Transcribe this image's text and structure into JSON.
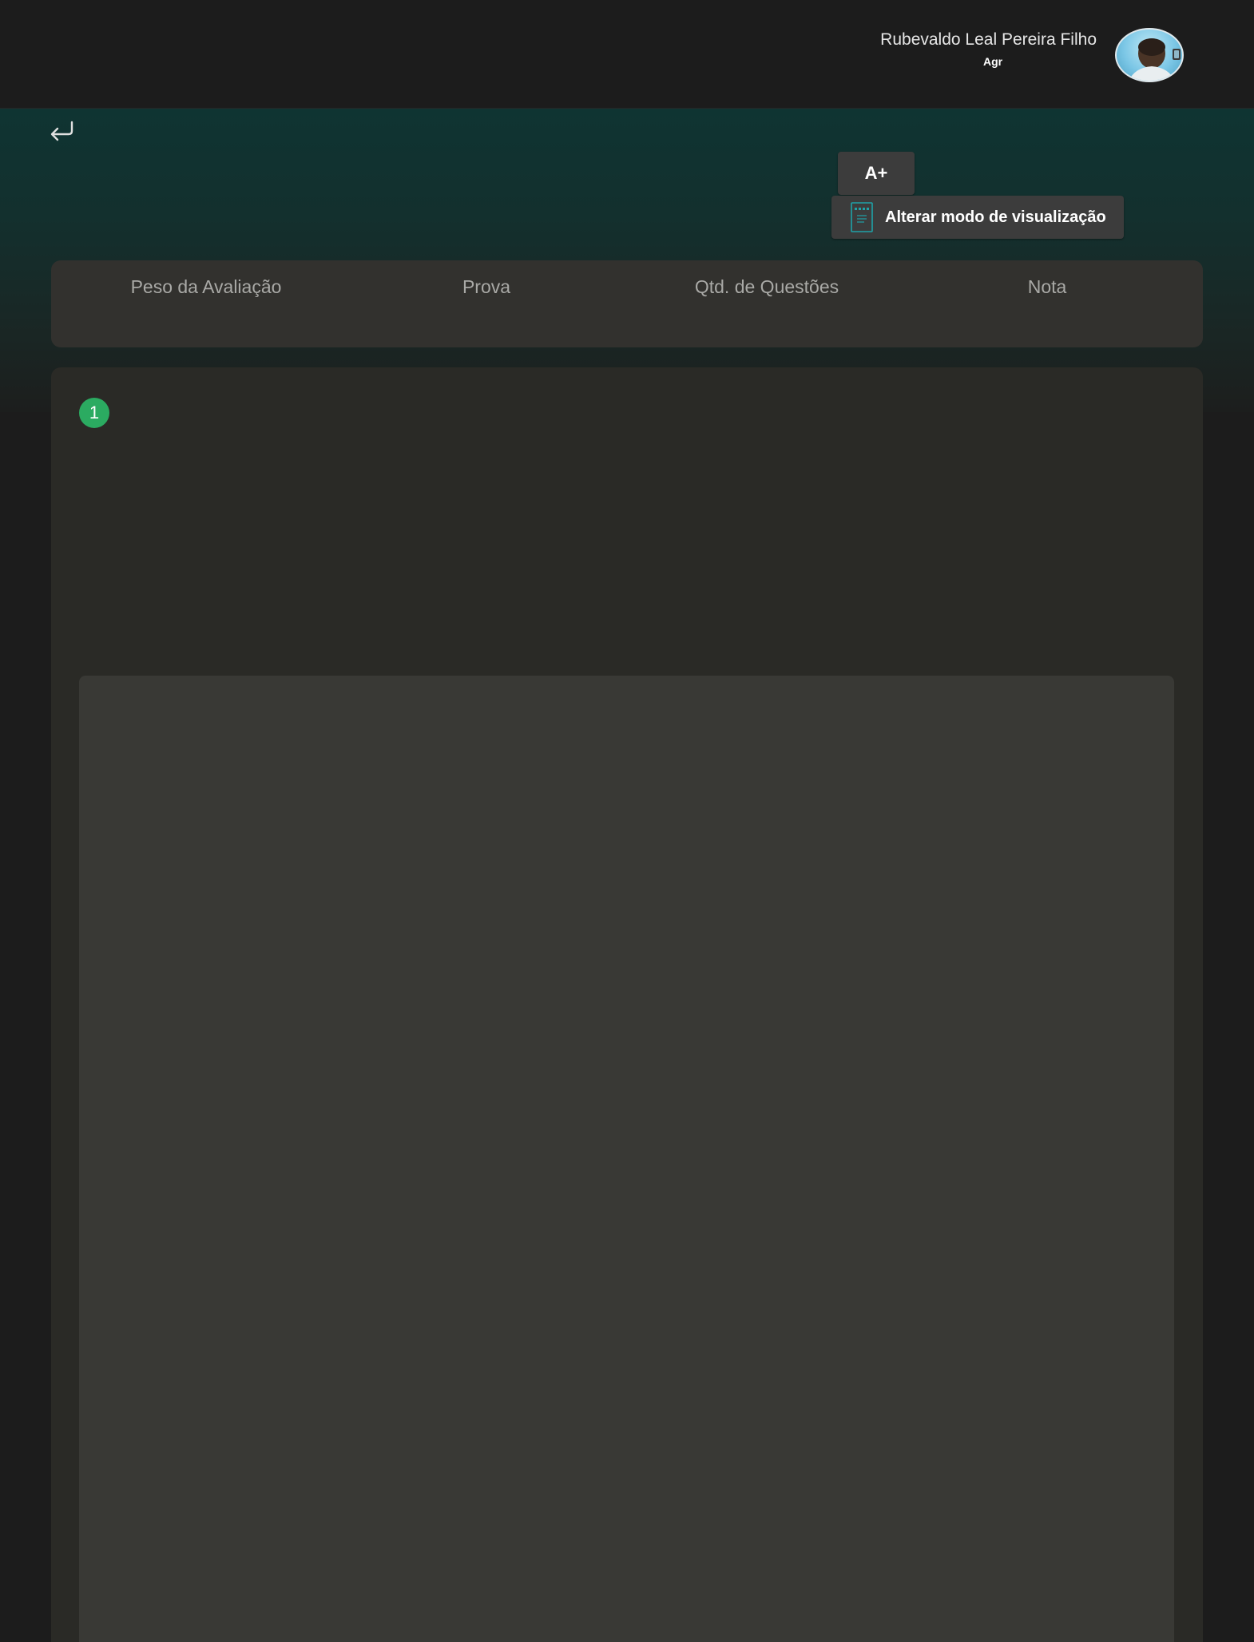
{
  "header": {
    "user_name": "Rubevaldo Leal Pereira Filho",
    "user_role": "Agr"
  },
  "toolbar": {
    "font_size_label": "A+",
    "view_mode_label": "Alterar modo de visualização"
  },
  "columns": [
    {
      "label": "Peso da Avaliação"
    },
    {
      "label": "Prova"
    },
    {
      "label": "Qtd. de Questões"
    },
    {
      "label": "Nota"
    }
  ],
  "question": {
    "number": "1"
  },
  "icons": {
    "back": "return-arrow-icon",
    "view_mode": "document-icon"
  },
  "colors": {
    "accent_green": "#2bab61",
    "teal_icon": "#1fa2a8",
    "hero_top": "#0f3432"
  }
}
